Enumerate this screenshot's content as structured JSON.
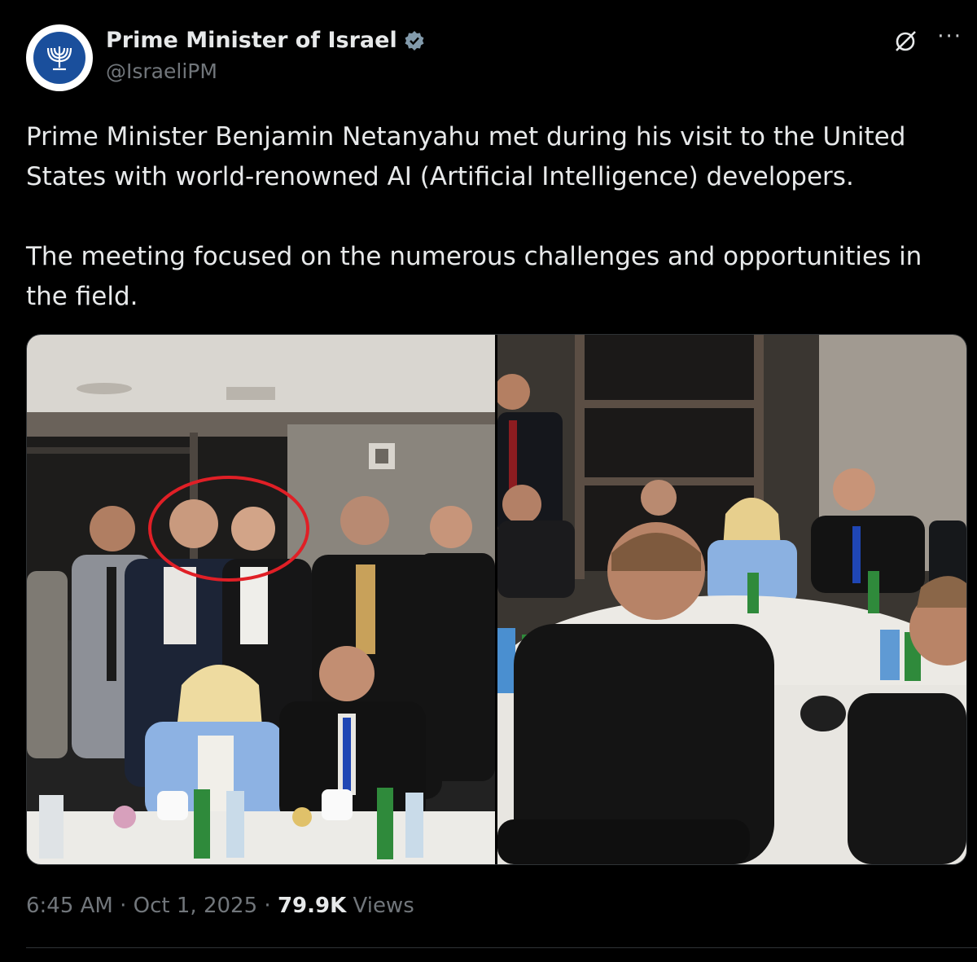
{
  "account": {
    "display_name": "Prime Minister of Israel",
    "handle": "@IsraeliPM",
    "verified": true,
    "avatar_icon": "menorah-emblem-icon"
  },
  "actions": {
    "grok_icon": "grok-icon",
    "more_icon": "more-options-icon",
    "more_label": "···"
  },
  "tweet": {
    "paragraphs": [
      "Prime Minister Benjamin Netanyahu met during his visit to the United States with world-renowned AI (Artificial Intelligence) developers.",
      "The meeting focused on the numerous challenges and opportunities in the field."
    ]
  },
  "media": {
    "photos": [
      {
        "name": "group-photo",
        "highlight": "red-circle"
      },
      {
        "name": "roundtable-photo"
      }
    ]
  },
  "meta": {
    "time": "6:45 AM",
    "separator": "·",
    "date": "Oct 1, 2025",
    "views_count": "79.9K",
    "views_label": "Views"
  },
  "colors": {
    "background": "#000000",
    "text": "#e7e9ea",
    "secondary": "#71767b",
    "highlight_circle": "#e01f26",
    "verified_badge": "#829aab"
  }
}
